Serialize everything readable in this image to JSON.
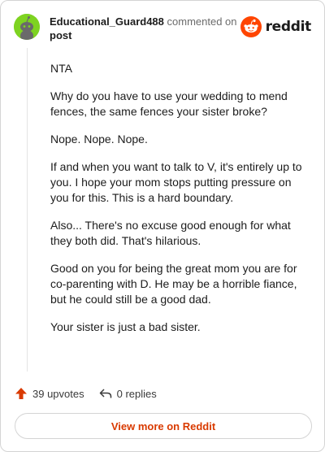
{
  "header": {
    "username": "Educational_Guard488",
    "commented_text": "commented on",
    "post_link": "post",
    "logo_text": "reddit"
  },
  "comment": {
    "paragraphs": [
      "NTA",
      "Why do you have to use your wedding to mend fences, the same fences your sister broke?",
      "Nope. Nope. Nope.",
      "If and when you want to talk to V, it's entirely up to you. I hope your mom stops putting pressure on you for this. This is a hard boundary.",
      "Also... There's no excuse good enough for what they both did. That's hilarious.",
      "Good on you for being the great mom you are for co-parenting with D. He may be a horrible fiance, but he could still be a good dad.",
      "Your sister is just a bad sister."
    ]
  },
  "actions": {
    "upvotes_label": "39 upvotes",
    "replies_label": "0 replies"
  },
  "footer": {
    "view_more_label": "View more on Reddit"
  },
  "colors": {
    "accent": "#d93a00",
    "avatar_bg": "#7ed321",
    "reddit_orange": "#ff4500"
  },
  "icons": {
    "avatar": "snoo-avatar-icon",
    "logo": "reddit-logo-icon",
    "upvote": "upvote-arrow-icon",
    "reply": "reply-arrow-icon"
  }
}
